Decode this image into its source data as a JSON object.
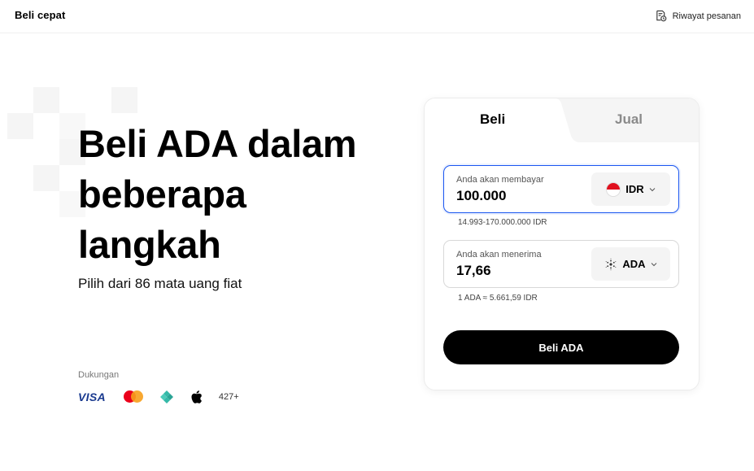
{
  "header": {
    "title": "Beli cepat",
    "history_label": "Riwayat pesanan"
  },
  "hero": {
    "title": "Beli ADA dalam beberapa langkah",
    "subtitle": "Pilih dari 86 mata uang fiat"
  },
  "support": {
    "label": "Dukungan",
    "visa_text": "VISA",
    "more_text": "427+",
    "methods": [
      "visa-icon",
      "mastercard-icon",
      "diamond-icon",
      "apple-icon"
    ]
  },
  "trade": {
    "tabs": [
      {
        "label": "Beli",
        "active": true
      },
      {
        "label": "Jual",
        "active": false
      }
    ],
    "pay": {
      "label": "Anda akan membayar",
      "value": "100.000",
      "currency": "IDR",
      "range_text": "14.993-170.000.000 IDR"
    },
    "receive": {
      "label": "Anda akan menerima",
      "value": "17,66",
      "currency": "ADA",
      "rate_text": "1 ADA ≈ 5.661,59 IDR"
    },
    "submit_label": "Beli ADA"
  },
  "colors": {
    "accent_focus": "#1a56f0",
    "button_bg": "#000000",
    "flag_red": "#e0101e",
    "visa_blue": "#1a3a8f"
  }
}
